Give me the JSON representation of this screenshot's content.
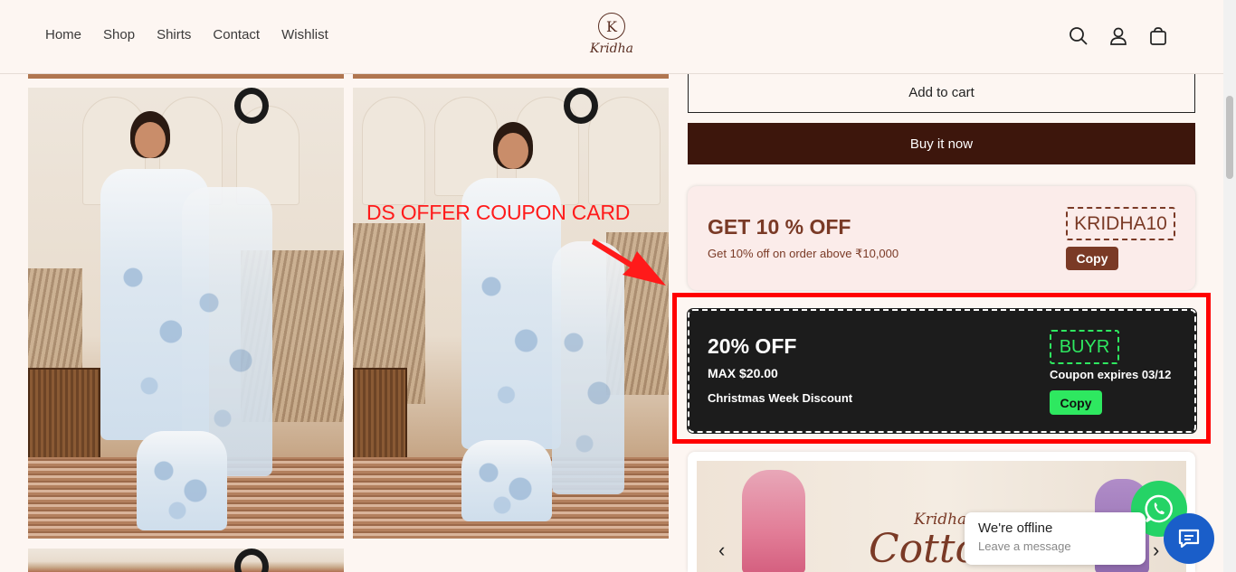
{
  "nav": {
    "items": [
      {
        "label": "Home"
      },
      {
        "label": "Shop"
      },
      {
        "label": "Shirts"
      },
      {
        "label": "Contact"
      },
      {
        "label": "Wishlist"
      }
    ]
  },
  "logo": {
    "monogram": "K",
    "wordmark": "Kridha"
  },
  "header_icons": [
    "search-icon",
    "account-icon",
    "cart-icon"
  ],
  "annotation": {
    "text": "DS OFFER COUPON CARD",
    "color": "#ff0000"
  },
  "product": {
    "add_to_cart_label": "Add to cart",
    "buy_now_label": "Buy it now"
  },
  "coupons": [
    {
      "title": "GET 10 % OFF",
      "description": "Get 10% off on order above ₹10,000",
      "code": "KRIDHA10",
      "copy_label": "Copy",
      "accent": "#7a3a26"
    },
    {
      "title": "20% OFF",
      "max": "MAX $20.00",
      "name": "Christmas Week Discount",
      "code": "BUYR",
      "expiry": "Coupon expires 03/12",
      "copy_label": "Copy",
      "accent": "#2ee860"
    }
  ],
  "banner": {
    "script_small": "Kridha",
    "script_large": "Cotto",
    "prev": "‹",
    "next": "›"
  },
  "chat": {
    "status": "We're offline",
    "prompt": "Leave a message"
  },
  "colors": {
    "page_bg": "#fdf6f2",
    "brand_dark": "#3d160c",
    "highlight": "#ff0000"
  }
}
